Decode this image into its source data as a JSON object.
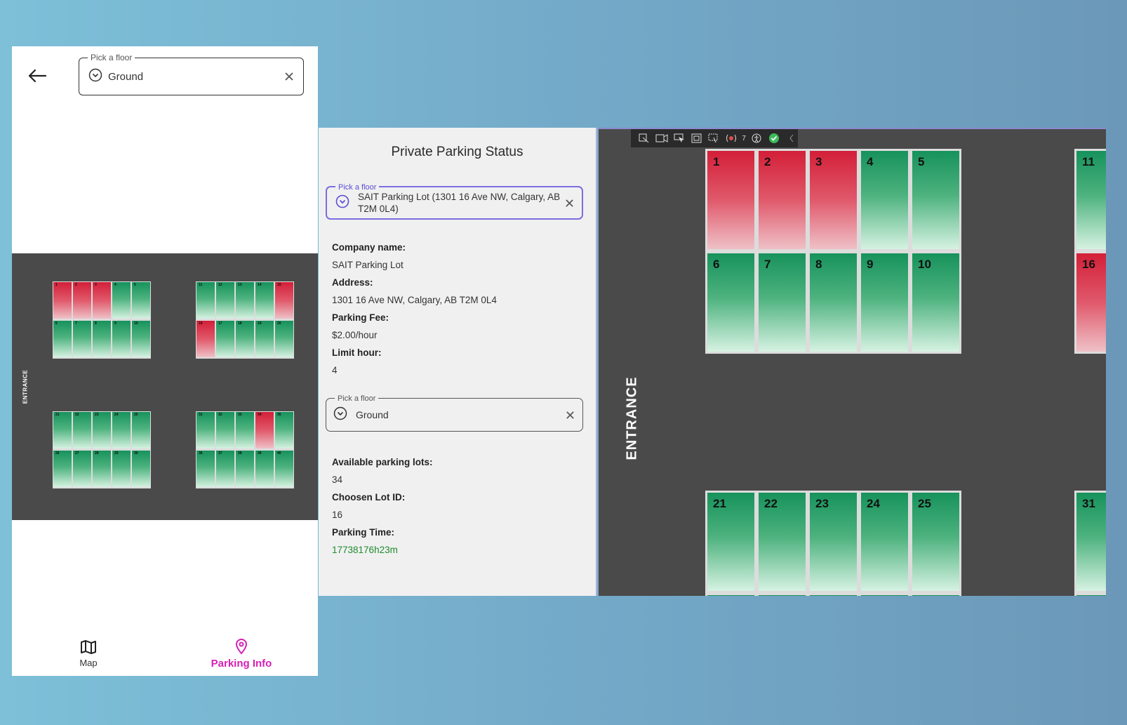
{
  "mobile": {
    "floor_picker": {
      "legend": "Pick a floor",
      "value": "Ground"
    },
    "map": {
      "entrance_label": "ENTRANCE"
    },
    "nav": [
      {
        "label": "Map",
        "icon": "map-icon",
        "active": false
      },
      {
        "label": "Parking Info",
        "icon": "location-pin-icon",
        "active": true
      }
    ]
  },
  "desktop": {
    "info": {
      "title": "Private Parking Status",
      "lot_picker": {
        "legend": "Pick a floor",
        "value": "SAIT Parking Lot (1301 16 Ave NW, Calgary, AB T2M 0L4)"
      },
      "company_label": "Company name:",
      "company_value": "SAIT Parking Lot",
      "address_label": "Address:",
      "address_value": "1301 16 Ave NW, Calgary, AB T2M 0L4",
      "fee_label": "Parking Fee:",
      "fee_value": "$2.00/hour",
      "limit_label": "Limit hour:",
      "limit_value": "4",
      "floor_picker": {
        "legend": "Pick a floor",
        "value": "Ground"
      },
      "available_label": "Available parking lots:",
      "available_value": "34",
      "chosen_label": "Choosen Lot ID:",
      "chosen_value": "16",
      "time_label": "Parking Time:",
      "time_value": "17738176h23m"
    },
    "toolbar": {
      "count": "7"
    },
    "map": {
      "entrance_label": "ENTRANCE"
    }
  },
  "spots": {
    "1": "taken",
    "2": "taken",
    "3": "taken",
    "4": "free",
    "5": "free",
    "6": "free",
    "7": "free",
    "8": "free",
    "9": "free",
    "10": "free",
    "11": "free",
    "12": "free",
    "13": "free",
    "14": "free",
    "15": "taken",
    "16": "taken",
    "17": "free",
    "18": "free",
    "19": "free",
    "20": "free",
    "21": "free",
    "22": "free",
    "23": "free",
    "24": "free",
    "25": "free",
    "26": "free",
    "27": "free",
    "28": "free",
    "29": "free",
    "30": "free",
    "31": "free",
    "32": "free",
    "33": "free",
    "34": "taken",
    "35": "free",
    "36": "free",
    "37": "free",
    "38": "free",
    "39": "free",
    "40": "free"
  },
  "colors": {
    "free": "#17925c",
    "taken": "#d31f38",
    "accent": "#d61fb4",
    "focus": "#7b6ee0",
    "map_bg": "#4a4a4a"
  }
}
